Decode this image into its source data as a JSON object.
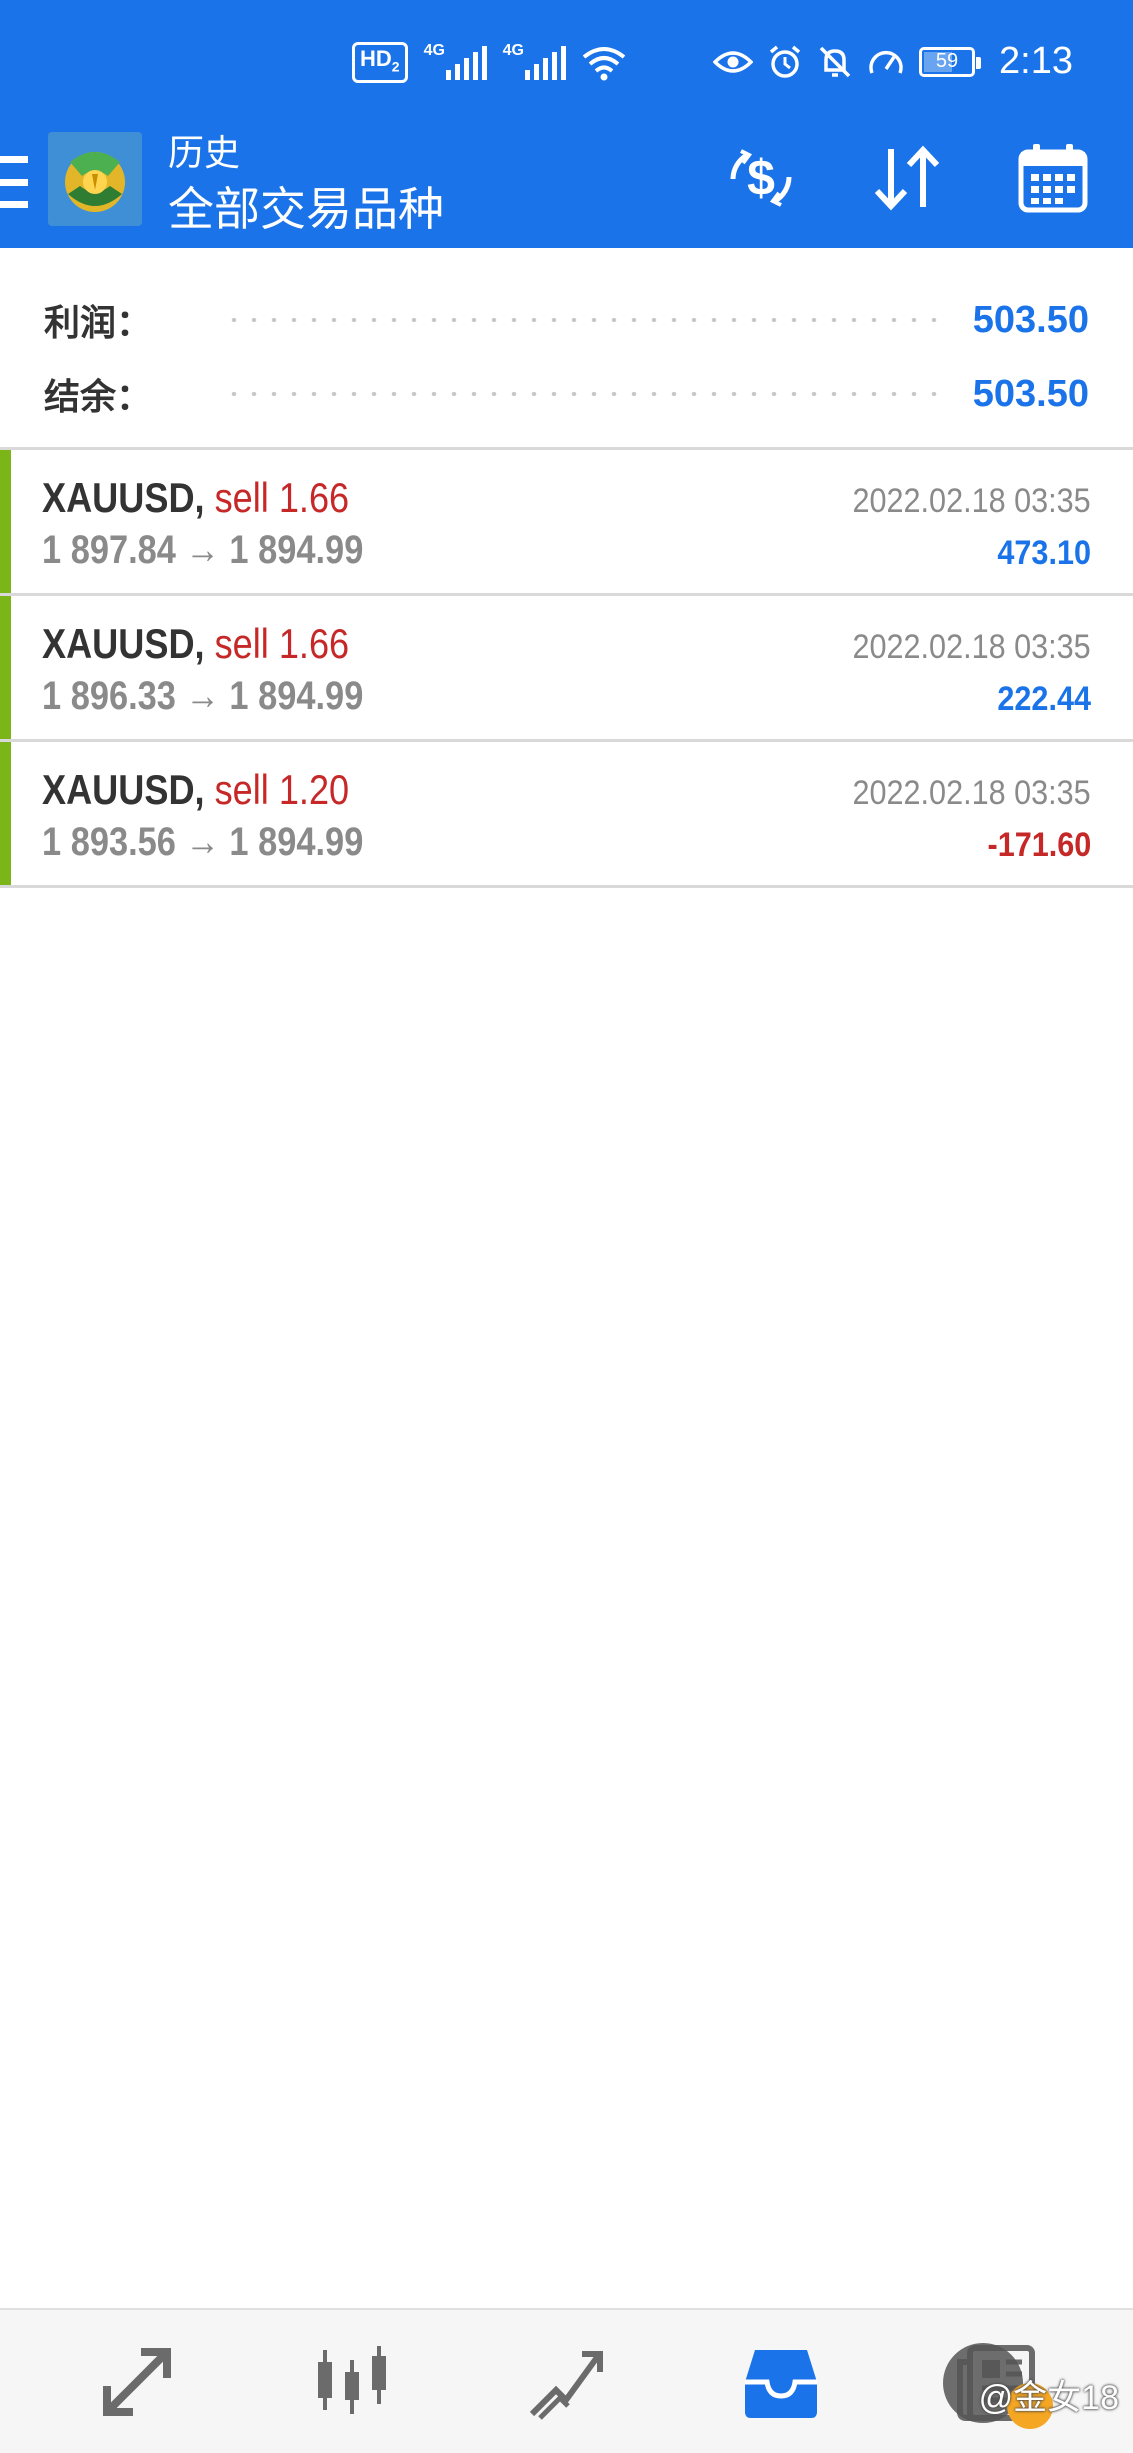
{
  "status_bar": {
    "hd_label": "HD",
    "hd_sub": "2",
    "net1": "4G",
    "net2": "4G",
    "battery": "59",
    "battery_level": 0.59,
    "time": "2:13"
  },
  "app_bar": {
    "title": "历史",
    "subtitle": "全部交易品种",
    "icons": [
      "menu-icon",
      "currency-exchange-icon",
      "sort-icon",
      "calendar-icon"
    ]
  },
  "summary": {
    "profit_label": "利润：",
    "profit_value": "503.50",
    "balance_label": "结余：",
    "balance_value": "503.50"
  },
  "deals": [
    {
      "symbol": "XAUUSD,",
      "side": "sell 1.66",
      "prices": "1 897.84 → 1 894.99",
      "time": "2022.02.18 03:35",
      "profit": "473.10",
      "profit_sign": "pos"
    },
    {
      "symbol": "XAUUSD,",
      "side": "sell 1.66",
      "prices": "1 896.33 → 1 894.99",
      "time": "2022.02.18 03:35",
      "profit": "222.44",
      "profit_sign": "pos"
    },
    {
      "symbol": "XAUUSD,",
      "side": "sell 1.20",
      "prices": "1 893.56 → 1 894.99",
      "time": "2022.02.18 03:35",
      "profit": "-171.60",
      "profit_sign": "neg"
    }
  ],
  "bottom_nav": {
    "items": [
      "quotes-icon",
      "chart-icon",
      "trade-icon",
      "history-icon",
      "news-icon"
    ],
    "active": "history-icon"
  },
  "watermark": "@金女18",
  "colors": {
    "primary": "#1a73e8",
    "sell": "#c62828",
    "deal_bar": "#7cb518",
    "muted": "#8a8a8a"
  }
}
